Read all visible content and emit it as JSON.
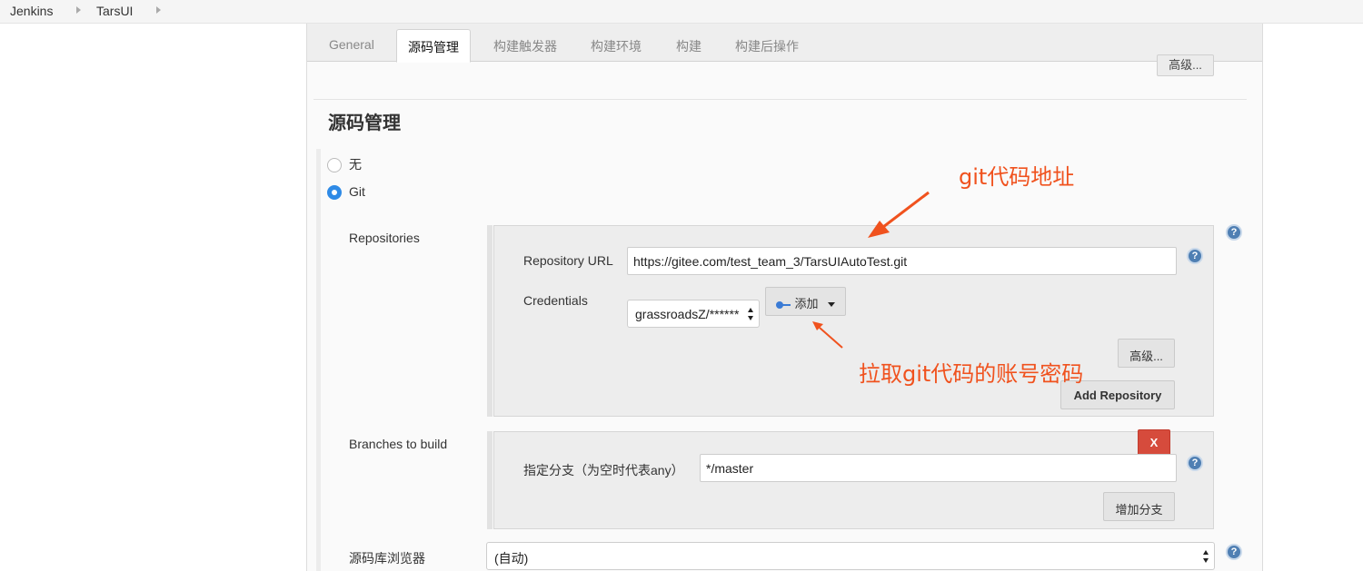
{
  "breadcrumb": {
    "items": [
      "Jenkins",
      "TarsUI"
    ]
  },
  "tabs": [
    "General",
    "源码管理",
    "构建触发器",
    "构建环境",
    "构建",
    "构建后操作"
  ],
  "active_tab": "源码管理",
  "top_advanced_button": "高级...",
  "section_title": "源码管理",
  "scm_options": {
    "none_label": "无",
    "git_label": "Git",
    "selected": "Git"
  },
  "repositories": {
    "label": "Repositories",
    "url_label": "Repository URL",
    "url_value": "https://gitee.com/test_team_3/TarsUIAutoTest.git",
    "credentials_label": "Credentials",
    "credentials_value": "grassroadsZ/******",
    "add_button": "添加",
    "advanced_button": "高级...",
    "add_repo_button": "Add Repository"
  },
  "branches": {
    "label": "Branches to build",
    "delete_button": "X",
    "spec_label": "指定分支（为空时代表any）",
    "spec_value": "*/master",
    "add_branch_button": "增加分支"
  },
  "browser": {
    "label": "源码库浏览器",
    "value": "(自动)"
  },
  "annotations": {
    "git_url_note": "git代码地址",
    "credentials_note": "拉取git代码的账号密码"
  },
  "colors": {
    "annotation": "#f0521e",
    "help_icon": "#4f7fb3",
    "delete_button": "#d64b3c",
    "radio_checked": "#2e8ae6"
  }
}
